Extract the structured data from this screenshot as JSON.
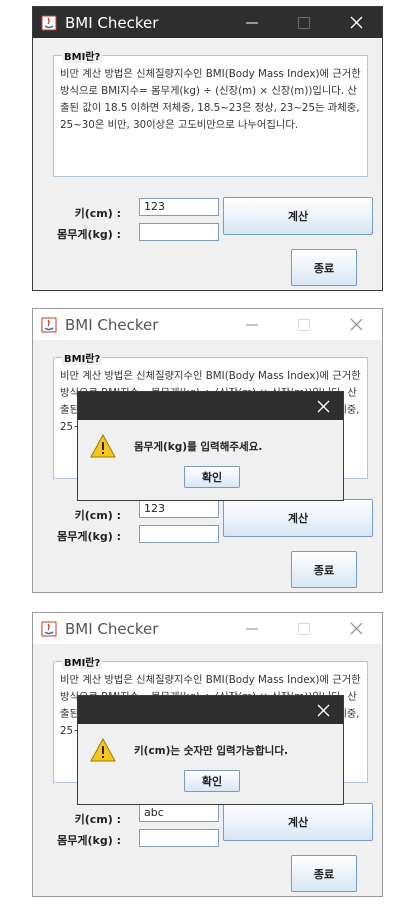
{
  "window": {
    "title": "BMI Checker",
    "minimize_icon": "minimize-icon",
    "maximize_icon": "maximize-icon",
    "close_icon": "close-icon"
  },
  "group": {
    "legend": "BMI란?",
    "description": "비만 계산 방법은 신체질량지수인 BMI(Body Mass Index)에 근거한방식으로 BMI지수= 몸무게(kg) ÷ (신장(m) × 신장(m))입니다. 산출된 값이 18.5 이하면 저체중, 18.5~23은 정상, 23~25는 과체중, 25~30은 비만, 30이상은 고도비만으로 나누어집니다."
  },
  "form": {
    "height_label": "키(cm) :",
    "weight_label": "몸무게(kg) :",
    "calc_label": "계산",
    "quit_label": "종료"
  },
  "screens": [
    {
      "height_value": "123",
      "weight_value": "",
      "dialog": null
    },
    {
      "height_value": "123",
      "weight_value": "",
      "dialog": {
        "message": "몸무게(kg)를 입력해주세요.",
        "ok_label": "확인"
      }
    },
    {
      "height_value": "abc",
      "weight_value": "",
      "dialog": {
        "message": "키(cm)는 숫자만 입력가능합니다.",
        "ok_label": "확인"
      }
    }
  ],
  "colors": {
    "titlebar_active": "#2e2e2e",
    "titlebar_inactive": "#ffffff",
    "window_bg": "#f0f0f0",
    "button_border": "#7a9abf",
    "warning": "#f5c518"
  }
}
